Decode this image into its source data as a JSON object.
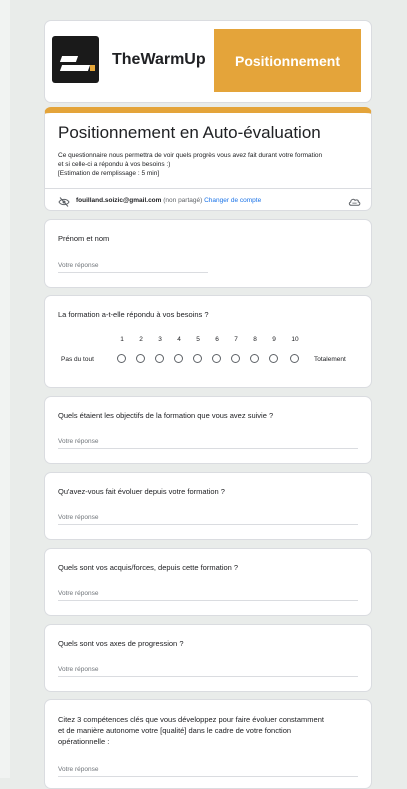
{
  "header": {
    "brand": "TheWarmUp",
    "tag": "Positionnement",
    "accent_color": "#e4a43a"
  },
  "form": {
    "title": "Positionnement en Auto-évaluation",
    "description_line1": "Ce questionnaire nous permettra de voir quels progrès vous avez fait durant votre formation",
    "description_line2": "et si celle-ci a répondu à vos besoins :)",
    "description_line3": "[Estimation de remplissage : 5 min]",
    "account_email": "fouilland.soizic@gmail.com",
    "account_note": "(non partagé)",
    "switch_account": "Changer de compte"
  },
  "placeholder": "Votre réponse",
  "questions": {
    "q1": "Prénom et nom",
    "q2": "La formation a-t-elle répondu à vos besoins ?",
    "q3": "Quels étaient les objectifs de la formation que vous avez suivie ?",
    "q4": "Qu'avez-vous fait évoluer depuis votre formation ?",
    "q5": "Quels sont vos acquis/forces, depuis cette formation ?",
    "q6": "Quels sont vos axes de progression ?",
    "q7_line1": "Citez 3 compétences clés que vous développez pour faire évoluer constamment",
    "q7_line2": "et de manière autonome votre [qualité] dans le cadre de votre fonction",
    "q7_line3": "opérationnelle :"
  },
  "scale": {
    "low_label": "Pas du tout",
    "high_label": "Totalement",
    "numbers": [
      "1",
      "2",
      "3",
      "4",
      "5",
      "6",
      "7",
      "8",
      "9",
      "10"
    ]
  }
}
